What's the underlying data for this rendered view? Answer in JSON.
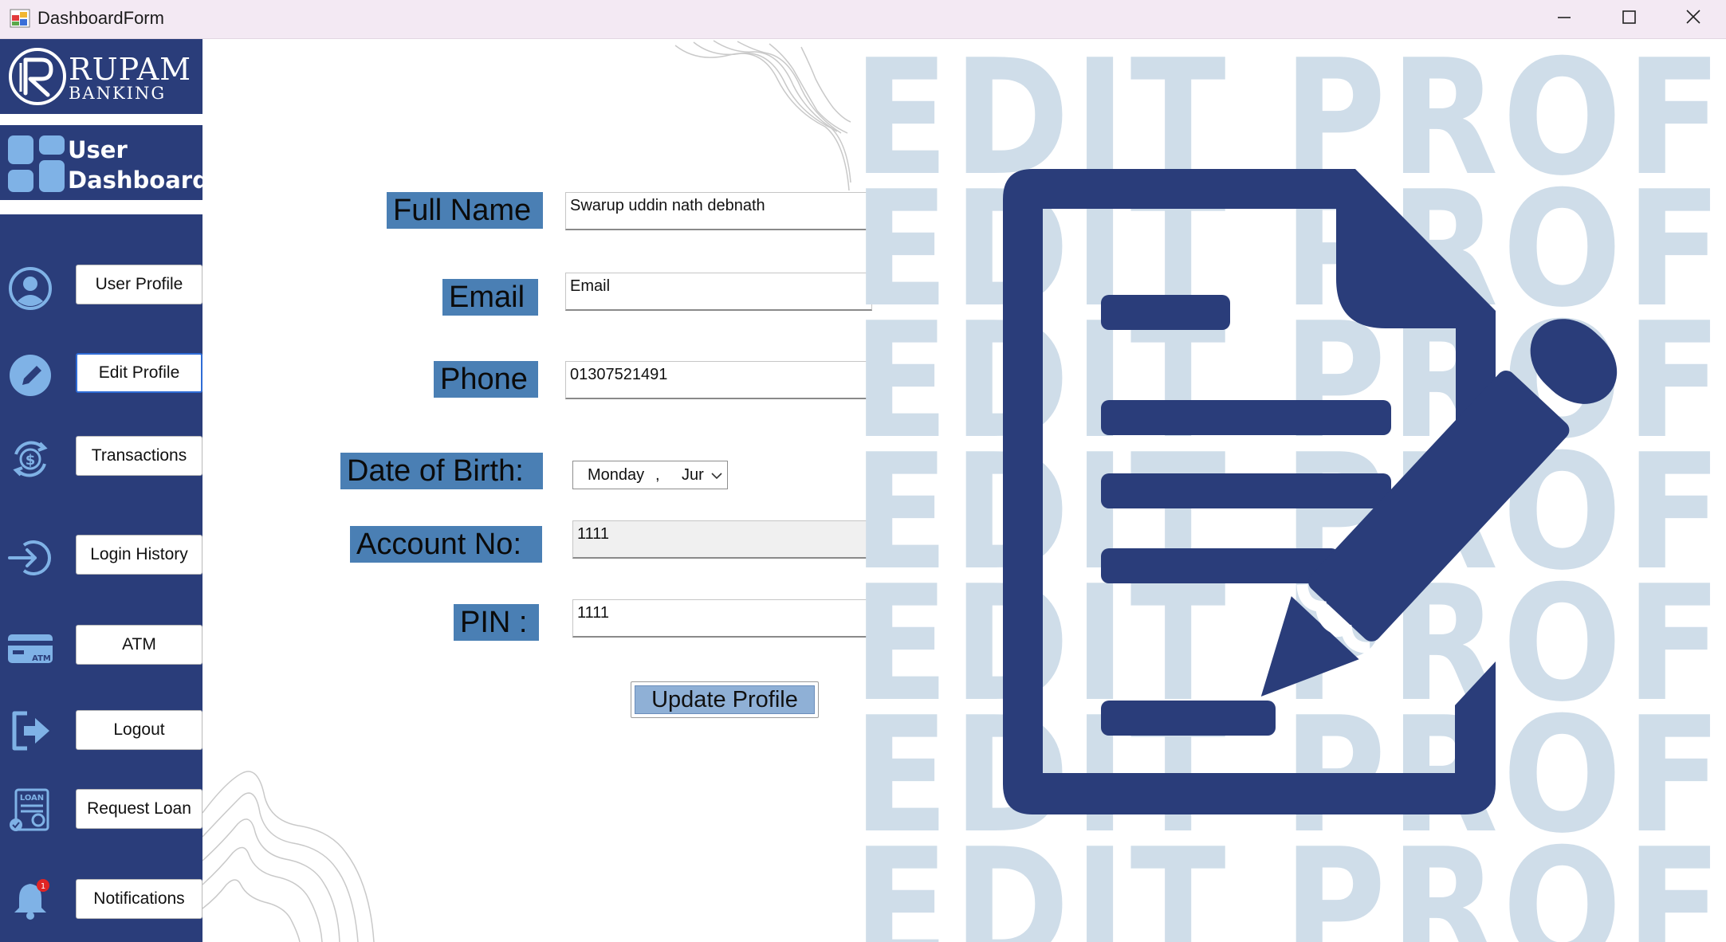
{
  "window": {
    "title": "DashboardForm"
  },
  "sidebar": {
    "logo": {
      "line1": "RUPAM",
      "line2": "BANKING"
    },
    "section": {
      "line1": "User",
      "line2": "Dashboard"
    },
    "items": [
      {
        "label": "User Profile",
        "icon": "user-icon"
      },
      {
        "label": "Edit Profile",
        "icon": "pencil-icon",
        "active": true
      },
      {
        "label": "Transactions",
        "icon": "dollar-cycle-icon"
      },
      {
        "label": "Login History",
        "icon": "login-icon"
      },
      {
        "label": "ATM",
        "icon": "atm-card-icon"
      },
      {
        "label": "Logout",
        "icon": "logout-icon"
      },
      {
        "label": "Request Loan",
        "icon": "loan-document-icon"
      },
      {
        "label": "Notifications",
        "icon": "bell-icon",
        "badge": "1"
      }
    ]
  },
  "form": {
    "full_name": {
      "label": "Full Name",
      "value": "Swarup uddin nath debnath"
    },
    "email": {
      "label": "Email",
      "value": "Email"
    },
    "phone": {
      "label": "Phone",
      "value": "01307521491"
    },
    "dob": {
      "label": "Date of Birth:",
      "day": "Monday",
      "sep": ",",
      "month": "Jur"
    },
    "account": {
      "label": "Account No:",
      "value": "1111"
    },
    "pin": {
      "label": "PIN :",
      "value": "1111"
    },
    "submit_label": "Update Profile"
  },
  "illustration": {
    "background_text": "EDIT PROFILE",
    "icon": "edit-document-icon"
  },
  "colors": {
    "sidebar": "#2a3d7a",
    "label_bg": "#4a7fb4",
    "watermark": "#cfdde9",
    "icon": "#2a3d7a"
  }
}
